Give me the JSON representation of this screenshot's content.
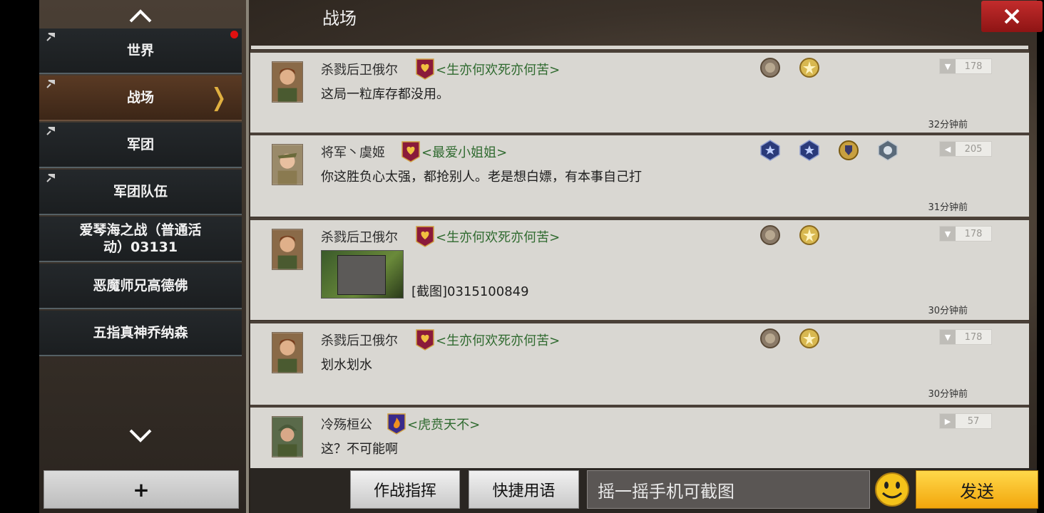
{
  "header": {
    "title": "战场"
  },
  "sidebar": {
    "channels": [
      {
        "label": "世界"
      },
      {
        "label": "战场"
      },
      {
        "label": "军团"
      },
      {
        "label": "军团队伍"
      },
      {
        "label": "爱琴海之战（普通活动）03131"
      },
      {
        "label": "恶魔师兄高德佛"
      },
      {
        "label": "五指真神乔纳森"
      }
    ],
    "add_label": "+"
  },
  "messages": [
    {
      "name": "杀戮后卫俄尔",
      "guild": "<生亦何欢死亦何苦>",
      "text": "这局一粒库存都没用。",
      "time": "32分钟前",
      "level": "178",
      "medals": [
        "bronze-medal",
        "gold-star-medal"
      ]
    },
    {
      "name": "将军丶虞姬",
      "guild": "<最爱小姐姐>",
      "text": "你这胜负心太强，都抢别人。老是想白嫖，有本事自己打",
      "time": "31分钟前",
      "level": "205",
      "medals": [
        "blue-star-medal",
        "blue-star-medal",
        "gold-shield-medal",
        "silver-star-medal"
      ]
    },
    {
      "name": "杀戮后卫俄尔",
      "guild": "<生亦何欢死亦何苦>",
      "text": "[截图]0315100849",
      "time": "30分钟前",
      "level": "178",
      "medals": [
        "bronze-medal",
        "gold-star-medal"
      ]
    },
    {
      "name": "杀戮后卫俄尔",
      "guild": "<生亦何欢死亦何苦>",
      "text": "划水划水",
      "time": "30分钟前",
      "level": "178",
      "medals": [
        "bronze-medal",
        "gold-star-medal"
      ]
    },
    {
      "name": "冷殇桓公",
      "guild": "<虎贲天不>",
      "text": "这？不可能啊",
      "time": "",
      "level": "57",
      "medals": []
    }
  ],
  "bottom": {
    "command_label": "作战指挥",
    "phrases_label": "快捷用语",
    "input_placeholder": "摇一摇手机可截图",
    "send_label": "发送"
  },
  "colors": {
    "guild_text": "#2f6a2f",
    "send_button": "#f2a60c",
    "close_button": "#c22c2c"
  }
}
